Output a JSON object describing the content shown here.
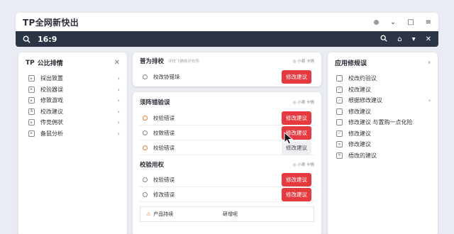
{
  "app": {
    "title": "TP全网新快出"
  },
  "search": {
    "query": "16:9"
  },
  "left_panel": {
    "title": "公比排情",
    "items": [
      {
        "label": "採出致置"
      },
      {
        "label": "校验器误"
      },
      {
        "label": "修致游戏"
      },
      {
        "label": "校改建议"
      },
      {
        "label": "传竞佣状"
      },
      {
        "label": "备鼠分析"
      }
    ]
  },
  "mid_top": {
    "title": "普为排校",
    "subtitle": "详校飞确维对布势",
    "meta": "◎ 小顿 卡情",
    "row": {
      "label": "校改协错垛",
      "button": "修改建议"
    }
  },
  "mid_main": {
    "section1": {
      "title": "须阵错验误",
      "meta": "◎ 小顿 卡情",
      "rows": [
        {
          "label": "校验错误",
          "button": "修改建议"
        },
        {
          "label": "校致错误",
          "button": "修改建议"
        },
        {
          "label": "校验错误",
          "button": "修改建议"
        }
      ]
    },
    "section2": {
      "title": "校验用权",
      "meta": "◎ 小顿 卡情",
      "rows": [
        {
          "label": "校验错误",
          "button": "修改建议"
        },
        {
          "label": "修改错误",
          "button": "修改建议"
        }
      ],
      "table": {
        "col1": "产品持续",
        "col2": "研增呢"
      }
    }
  },
  "right_panel": {
    "title": "应用修规误",
    "items": [
      {
        "label": "校改约验议"
      },
      {
        "label": "校改建议"
      },
      {
        "label": "根据修改建议"
      },
      {
        "label": "修改建议"
      },
      {
        "label": "修改建议 与置购一点化险"
      },
      {
        "label": "修改建议"
      },
      {
        "label": "修改建议"
      },
      {
        "label": "梧改的建议"
      }
    ]
  }
}
